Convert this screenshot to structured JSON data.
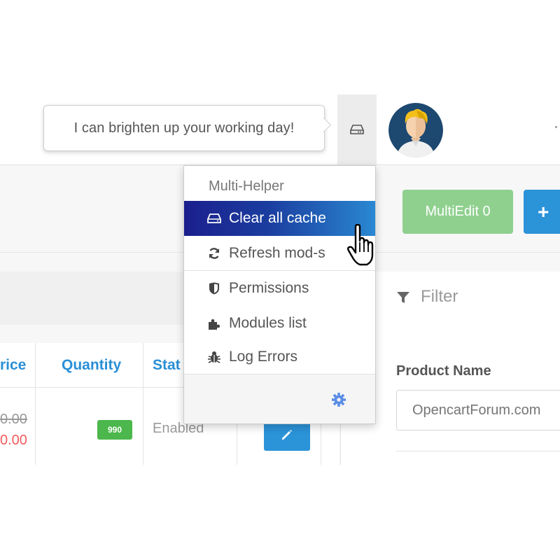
{
  "header": {
    "tooltip_text": "I can brighten up your working day!",
    "cache_button_icon": "hdd-icon",
    "avatar_icon": "user-avatar"
  },
  "toolbar": {
    "multiedit_label": "MultiEdit 0",
    "add_label": "+"
  },
  "table": {
    "headers": [
      "rice",
      "Quantity",
      "Stat"
    ],
    "row": {
      "old_price": "0.00",
      "new_price": "0.00",
      "quantity": "990",
      "status": "Enabled"
    }
  },
  "filter": {
    "title": "Filter",
    "product_name_label": "Product Name",
    "product_name_placeholder": "OpencartForum.com"
  },
  "dropdown": {
    "header": "Multi-Helper",
    "items": [
      {
        "label": "Clear all cache",
        "icon": "hdd-icon"
      },
      {
        "label": "Refresh mod-s",
        "icon": "refresh-icon"
      },
      {
        "label": "Permissions",
        "icon": "shield-icon"
      },
      {
        "label": "Modules list",
        "icon": "puzzle-icon"
      },
      {
        "label": "Log Errors",
        "icon": "bug-icon"
      }
    ],
    "settings_icon": "gear-icon"
  },
  "colors": {
    "active_gradient_start": "#1b1f8d",
    "active_gradient_end": "#2a88d2",
    "link_blue": "#2a8fd6",
    "success_green": "#4cb74c",
    "multiedit_green": "#8fd08f",
    "price_red": "#f25b5b"
  }
}
